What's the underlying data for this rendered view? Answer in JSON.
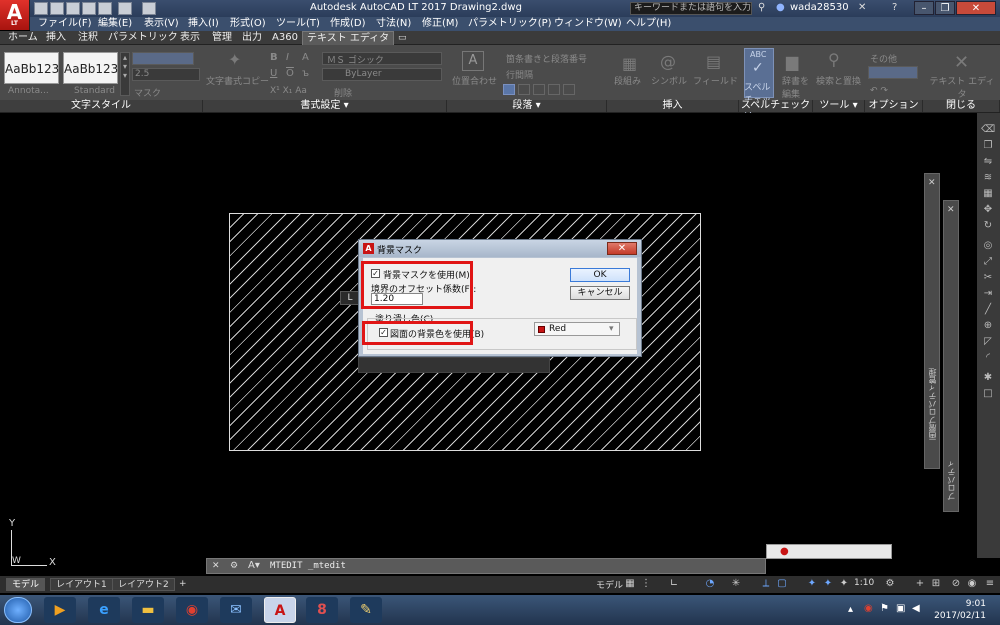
{
  "titlebar": {
    "logo_text": "A",
    "logo_sub": "LT",
    "title": "Autodesk AutoCAD LT 2017     Drawing2.dwg",
    "search_placeholder": "キーワードまたは語句を入力",
    "user": "wada28530"
  },
  "menus": [
    "ファイル(F)",
    "編集(E)",
    "表示(V)",
    "挿入(I)",
    "形式(O)",
    "ツール(T)",
    "作成(D)",
    "寸法(N)",
    "修正(M)",
    "パラメトリック(P)",
    "ウィンドウ(W)",
    "ヘルプ(H)"
  ],
  "ribbon_tabs": [
    "ホーム",
    "挿入",
    "注釈",
    "パラメトリック",
    "表示",
    "管理",
    "出力",
    "A360",
    "テキスト エディタ"
  ],
  "ribbon": {
    "style_swatch_1": "AaBb123",
    "style_swatch_2": "AaBb123",
    "style_name_1": "Annota...",
    "style_name_2": "Standard",
    "text_height": "2.5",
    "mask_label": "マスク",
    "match_text": "文字書式コピー",
    "font_name": "ＭＳ ゴシック",
    "color_name": "ByLayer",
    "clear_label": "削除",
    "justify_label": "位置合わせ",
    "bullets_label": "箇条書きと段落番号",
    "line_spacing_label": "行間隔",
    "columns_label": "段組み",
    "symbol_label": "シンボル",
    "field_label": "フィールド",
    "spell_label": "スペル\nチェック",
    "dict_label": "辞書を\n編集",
    "find_label": "検索と置換",
    "more_label": "その他",
    "close_label": "テキスト エディタ\nを閉じる",
    "panels": {
      "text_style": "文字スタイル",
      "format": "書式設定 ▾",
      "paragraph": "段落 ▾",
      "insert": "挿入",
      "spell": "スペルチェック ▾",
      "tools": "ツール ▾",
      "options": "オプション",
      "close": "閉じる"
    }
  },
  "dialog": {
    "title": "背景マスク",
    "use_mask_label": "背景マスクを使用(M)",
    "use_mask_checked": "✓",
    "offset_label": "境界のオフセット係数(F):",
    "offset_value": "1.20",
    "fill_color_label": "塗り潰し色(C)",
    "use_bg_label": "図面の背景色を使用(B)",
    "use_bg_checked": "✓",
    "color_value": "Red",
    "ok_label": "OK",
    "cancel_label": "キャンセル"
  },
  "palettes": {
    "properties_1": "画層プロパティ管理",
    "properties_2": "プロパティ"
  },
  "ucs": {
    "y": "Y",
    "x": "X",
    "w": "W"
  },
  "command_line": {
    "text": "MTEDIT _mtedit"
  },
  "layout_tabs": [
    "モデル",
    "レイアウト1",
    "レイアウト2",
    "+"
  ],
  "status": {
    "model": "モデル",
    "scale": "1:10"
  },
  "taskbar": {
    "time": "9:01",
    "date": "2017/02/11"
  },
  "colors": {
    "red_frame": "#e01515",
    "swatch_red": "#c81414",
    "ribbon_bg": "#4b4b4b"
  }
}
